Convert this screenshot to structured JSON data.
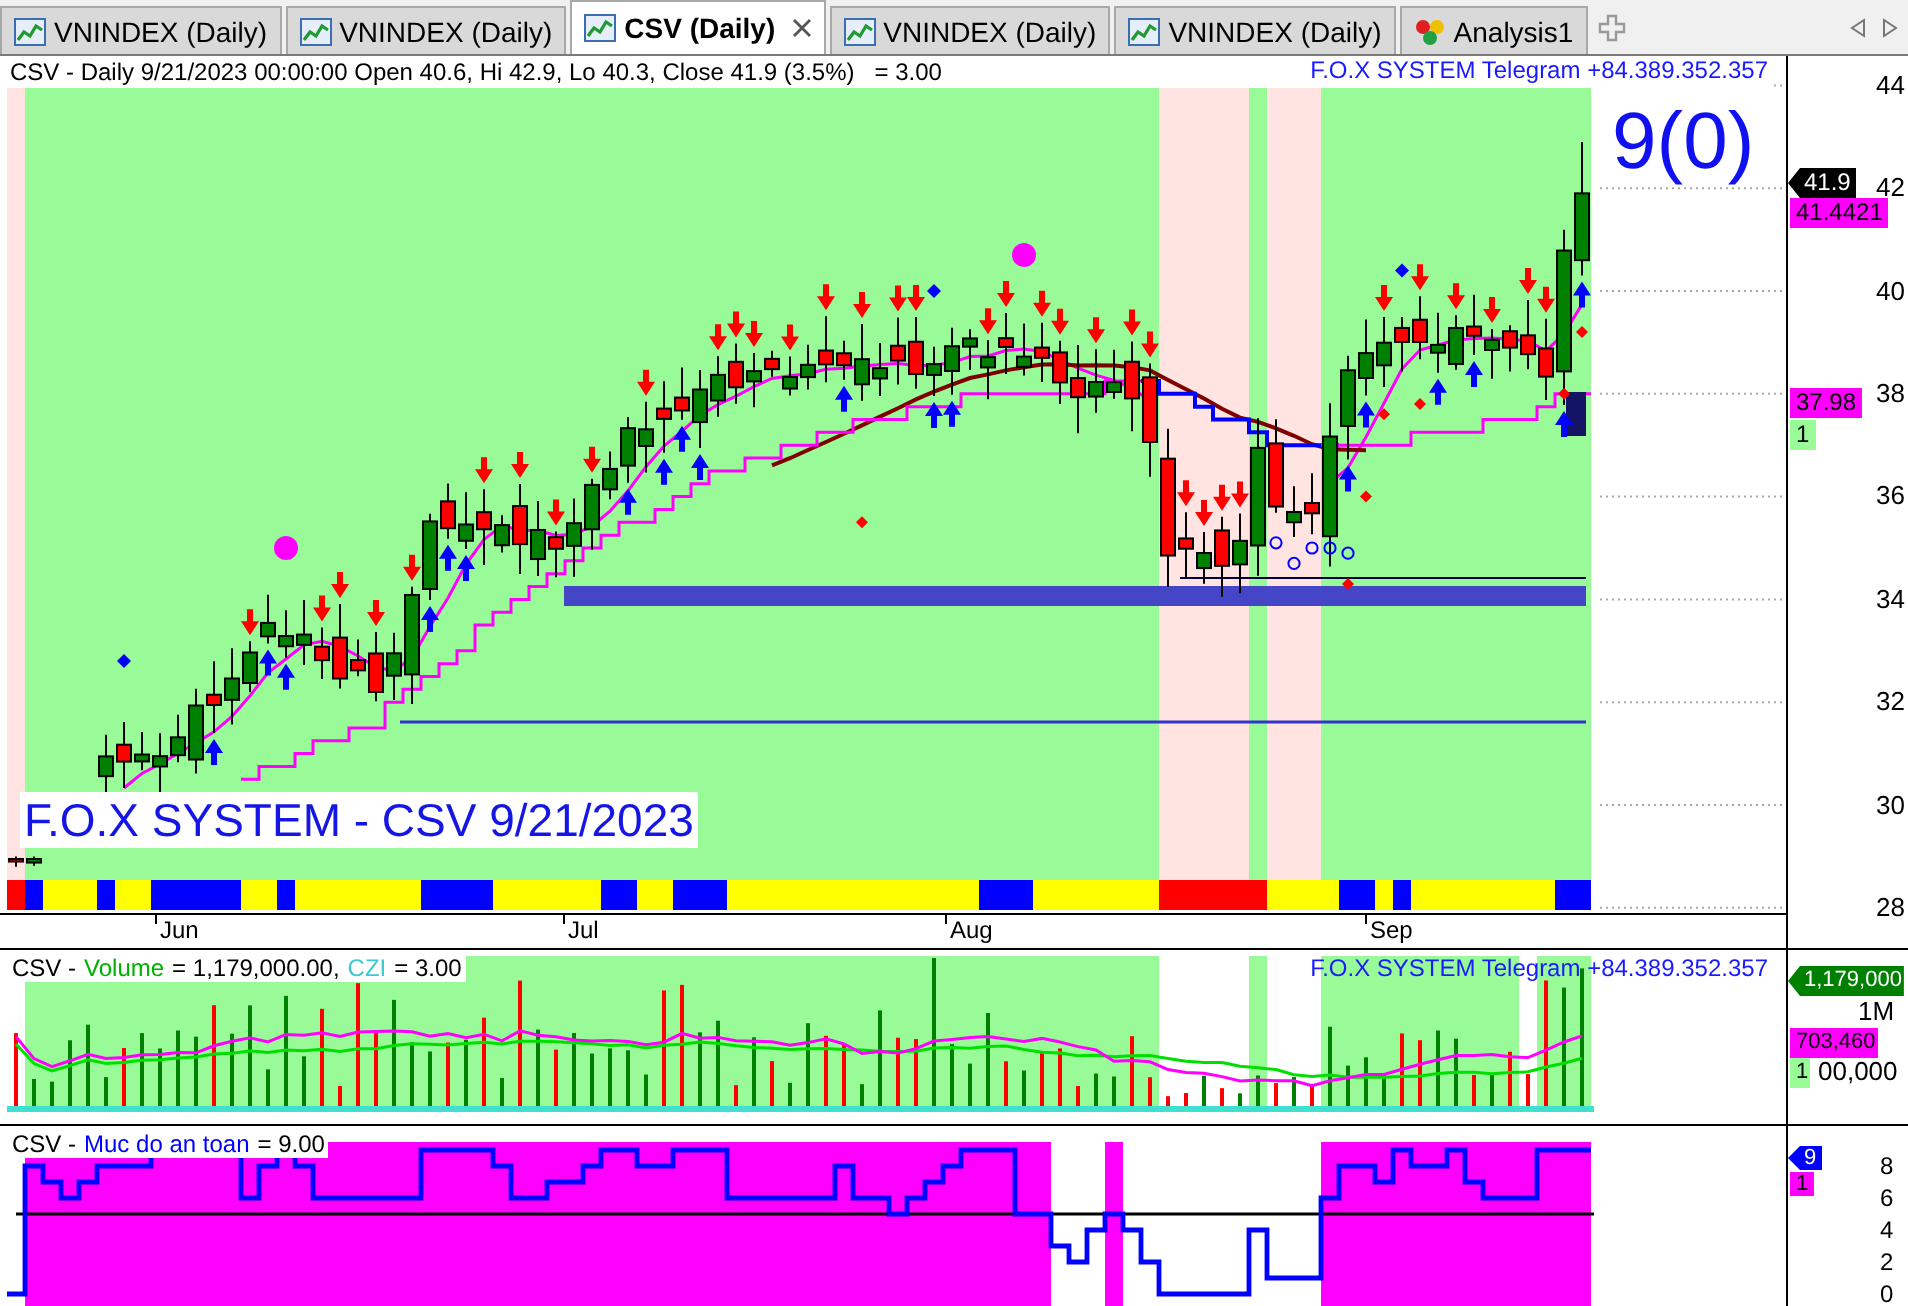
{
  "tabs": [
    {
      "label": "VNINDEX (Daily)",
      "kind": "chart",
      "selected": false
    },
    {
      "label": "VNINDEX (Daily)",
      "kind": "chart",
      "selected": false
    },
    {
      "label": "CSV (Daily)",
      "kind": "chart",
      "selected": true
    },
    {
      "label": "VNINDEX (Daily)",
      "kind": "chart",
      "selected": false
    },
    {
      "label": "VNINDEX (Daily)",
      "kind": "chart",
      "selected": false
    },
    {
      "label": "Analysis1",
      "kind": "analysis",
      "selected": false
    }
  ],
  "price_pane": {
    "header": "CSV - Daily 9/21/2023 00:00:00 Open 40.6, Hi 42.9, Lo 40.3, Close 41.9 (3.5%)   = 3.00",
    "contact": "F.O.X SYSTEM Telegram +84.389.352.357",
    "signal_count": "9(0)",
    "caption": "F.O.X SYSTEM - CSV 9/21/2023",
    "y_labels": [
      "44",
      "42",
      "40",
      "38",
      "36",
      "34",
      "32",
      "30",
      "28"
    ],
    "x_labels": [
      "Jun",
      "Jul",
      "Aug",
      "Sep"
    ],
    "badges": [
      {
        "text": "41.9",
        "kind": "pointer",
        "color": "#000000"
      },
      {
        "text": "41.4421",
        "kind": "tag",
        "color": "#ff00ff"
      },
      {
        "text": "37.98",
        "kind": "tag",
        "color": "#ff00ff"
      },
      {
        "text": "1",
        "kind": "tag",
        "color": "#98fb98"
      }
    ]
  },
  "volume_pane": {
    "legend": {
      "symbol": "CSV -",
      "items": [
        {
          "name": "Volume",
          "value": "= 1,179,000.00,",
          "color": "#00b000"
        },
        {
          "name": "CZI",
          "value": "= 3.00",
          "color": "#3cc8d0"
        }
      ]
    },
    "contact": "F.O.X SYSTEM Telegram +84.389.352.357",
    "y_labels": [
      "1M",
      "00,000"
    ],
    "badges": [
      {
        "text": "1,179,000",
        "kind": "pointer",
        "color": "#008000"
      },
      {
        "text": "703,460",
        "kind": "tag",
        "color": "#ff00ff"
      },
      {
        "text": "1",
        "kind": "tag",
        "color": "#98fb98"
      }
    ]
  },
  "safety_pane": {
    "legend": {
      "symbol": "CSV -",
      "items": [
        {
          "name": "Muc do an toan",
          "value": "= 9.00",
          "color": "#0000ff"
        }
      ]
    },
    "y_labels": [
      "8",
      "6",
      "4",
      "2",
      "0"
    ],
    "badges": [
      {
        "text": "9",
        "kind": "pointer",
        "color": "#0000ff"
      },
      {
        "text": "1",
        "kind": "tag",
        "color": "#ff00ff"
      }
    ]
  }
}
